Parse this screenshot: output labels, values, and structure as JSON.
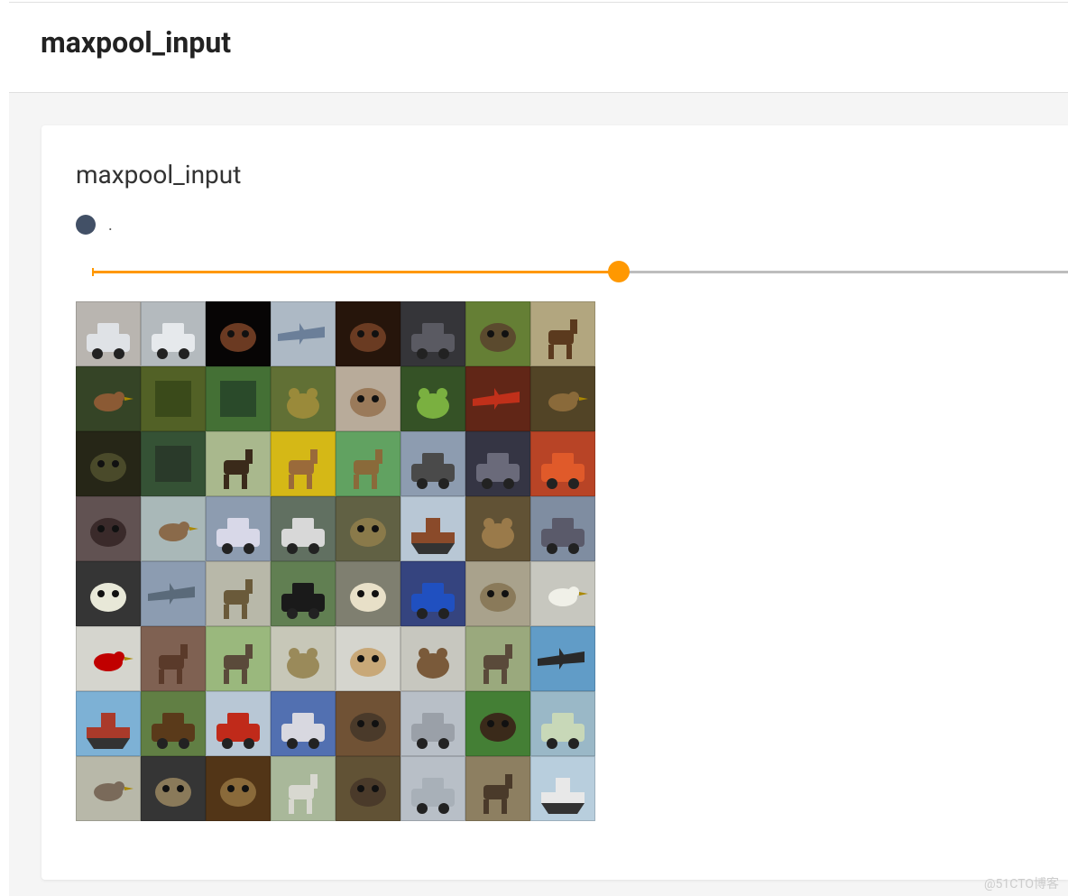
{
  "header": {
    "title": "maxpool_input"
  },
  "card": {
    "title": "maxpool_input",
    "run_color": "#425066",
    "run_label": ".",
    "slider": {
      "fill_percent": 54,
      "thumb_percent": 54
    }
  },
  "grid": {
    "rows": 8,
    "cols": 8,
    "thumbs": [
      {
        "bg": "#c9c5bf",
        "fg": "#dfe2e6",
        "s": "car"
      },
      {
        "bg": "#c4cacf",
        "fg": "#e6e9ec",
        "s": "truck"
      },
      {
        "bg": "#080606",
        "fg": "#6b3a22",
        "s": "animal"
      },
      {
        "bg": "#bcc9d6",
        "fg": "#6b7f99",
        "s": "plane"
      },
      {
        "bg": "#2a170c",
        "fg": "#6a3b22",
        "s": "animal"
      },
      {
        "bg": "#3a3a3e",
        "fg": "#5a5a62",
        "s": "truck"
      },
      {
        "bg": "#6e8a3a",
        "fg": "#5b4a2e",
        "s": "dog"
      },
      {
        "bg": "#c2b58a",
        "fg": "#5b3a1e",
        "s": "horse"
      },
      {
        "bg": "#3a4a2a",
        "fg": "#8b5a34",
        "s": "bird"
      },
      {
        "bg": "#5a6a2a",
        "fg": "#3a4a1a",
        "s": "nature"
      },
      {
        "bg": "#4a7a3a",
        "fg": "#2a4a2a",
        "s": "nature"
      },
      {
        "bg": "#6a7a3a",
        "fg": "#9a8a3a",
        "s": "frog"
      },
      {
        "bg": "#c8baa8",
        "fg": "#9a7a5a",
        "s": "cat"
      },
      {
        "bg": "#3a5a2a",
        "fg": "#7ab040",
        "s": "frog"
      },
      {
        "bg": "#6a2a1a",
        "fg": "#c0301a",
        "s": "plane"
      },
      {
        "bg": "#5a4a2a",
        "fg": "#8a6a3a",
        "s": "bird"
      },
      {
        "bg": "#2a2a1a",
        "fg": "#4a4a2a",
        "s": "animal"
      },
      {
        "bg": "#3a5a3a",
        "fg": "#2a3a2a",
        "s": "nature"
      },
      {
        "bg": "#b8c89a",
        "fg": "#3a2a1a",
        "s": "horse"
      },
      {
        "bg": "#e8c818",
        "fg": "#9a6a3a",
        "s": "horse"
      },
      {
        "bg": "#6ab06a",
        "fg": "#8a6a3a",
        "s": "deer"
      },
      {
        "bg": "#9aaabf",
        "fg": "#4a4a4a",
        "s": "truck"
      },
      {
        "bg": "#3a3a4a",
        "fg": "#6a6a7a",
        "s": "car"
      },
      {
        "bg": "#c84a2a",
        "fg": "#e05a2a",
        "s": "truck"
      },
      {
        "bg": "#6a5a5a",
        "fg": "#3a2a2a",
        "s": "cat"
      },
      {
        "bg": "#b8c8c8",
        "fg": "#8a6a4a",
        "s": "bird"
      },
      {
        "bg": "#9aaabf",
        "fg": "#d8d8e8",
        "s": "truck"
      },
      {
        "bg": "#6a7a6a",
        "fg": "#d8d8d8",
        "s": "car"
      },
      {
        "bg": "#6a6a4a",
        "fg": "#8a7a4a",
        "s": "animal"
      },
      {
        "bg": "#c8d8e8",
        "fg": "#8a4a2a",
        "s": "ship"
      },
      {
        "bg": "#6a5a3a",
        "fg": "#9a7a4a",
        "s": "frog"
      },
      {
        "bg": "#8a9aaf",
        "fg": "#5a5a6a",
        "s": "truck"
      },
      {
        "bg": "#3a3a3a",
        "fg": "#e8e8d8",
        "s": "animal"
      },
      {
        "bg": "#98aac0",
        "fg": "#5a6a7a",
        "s": "plane"
      },
      {
        "bg": "#c8c8b8",
        "fg": "#6a5a3a",
        "s": "deer"
      },
      {
        "bg": "#6a8a5a",
        "fg": "#1a1a1a",
        "s": "car"
      },
      {
        "bg": "#8a8a7a",
        "fg": "#e8e0c8",
        "s": "dog"
      },
      {
        "bg": "#3a4a8a",
        "fg": "#2050c0",
        "s": "car"
      },
      {
        "bg": "#b8b098",
        "fg": "#8a7a5a",
        "s": "dog"
      },
      {
        "bg": "#d8d8d0",
        "fg": "#f0f0e8",
        "s": "bird"
      },
      {
        "bg": "#e8e8e0",
        "fg": "#c00000",
        "s": "bird"
      },
      {
        "bg": "#8a6a5a",
        "fg": "#5a3a2a",
        "s": "horse"
      },
      {
        "bg": "#a8c888",
        "fg": "#5a4a3a",
        "s": "horse"
      },
      {
        "bg": "#d8d8c8",
        "fg": "#9a8a5a",
        "s": "frog"
      },
      {
        "bg": "#e8e8e0",
        "fg": "#c8a878",
        "s": "cat"
      },
      {
        "bg": "#d8d8d0",
        "fg": "#7a5a3a",
        "s": "frog"
      },
      {
        "bg": "#a8b888",
        "fg": "#5a4a3a",
        "s": "deer"
      },
      {
        "bg": "#6aaad8",
        "fg": "#2a2a2a",
        "s": "plane"
      },
      {
        "bg": "#88c0e8",
        "fg": "#aa3a2a",
        "s": "ship"
      },
      {
        "bg": "#6a8a4a",
        "fg": "#5a3a1a",
        "s": "truck"
      },
      {
        "bg": "#c8d8e8",
        "fg": "#c02a1a",
        "s": "truck"
      },
      {
        "bg": "#5a7ac0",
        "fg": "#d8d8e0",
        "s": "truck"
      },
      {
        "bg": "#7a5a3a",
        "fg": "#4a3a2a",
        "s": "animal"
      },
      {
        "bg": "#c8d0d8",
        "fg": "#9aa0a8",
        "s": "car"
      },
      {
        "bg": "#4a8a3a",
        "fg": "#3a2a1a",
        "s": "animal"
      },
      {
        "bg": "#a8c8d8",
        "fg": "#c8d8b8",
        "s": "car"
      },
      {
        "bg": "#c8c8b8",
        "fg": "#7a6a5a",
        "s": "bird"
      },
      {
        "bg": "#3a3a3a",
        "fg": "#8a7a5a",
        "s": "animal"
      },
      {
        "bg": "#5a3a1a",
        "fg": "#8a6a3a",
        "s": "animal"
      },
      {
        "bg": "#b8c8a8",
        "fg": "#d8d8d0",
        "s": "horse"
      },
      {
        "bg": "#6a5a3a",
        "fg": "#4a3a2a",
        "s": "animal"
      },
      {
        "bg": "#c8d0d8",
        "fg": "#a8b0b8",
        "s": "car"
      },
      {
        "bg": "#9a8a6a",
        "fg": "#4a3a2a",
        "s": "horse"
      },
      {
        "bg": "#c8e0f0",
        "fg": "#e8e8e8",
        "s": "ship"
      }
    ]
  },
  "watermark": "@51CTO博客"
}
